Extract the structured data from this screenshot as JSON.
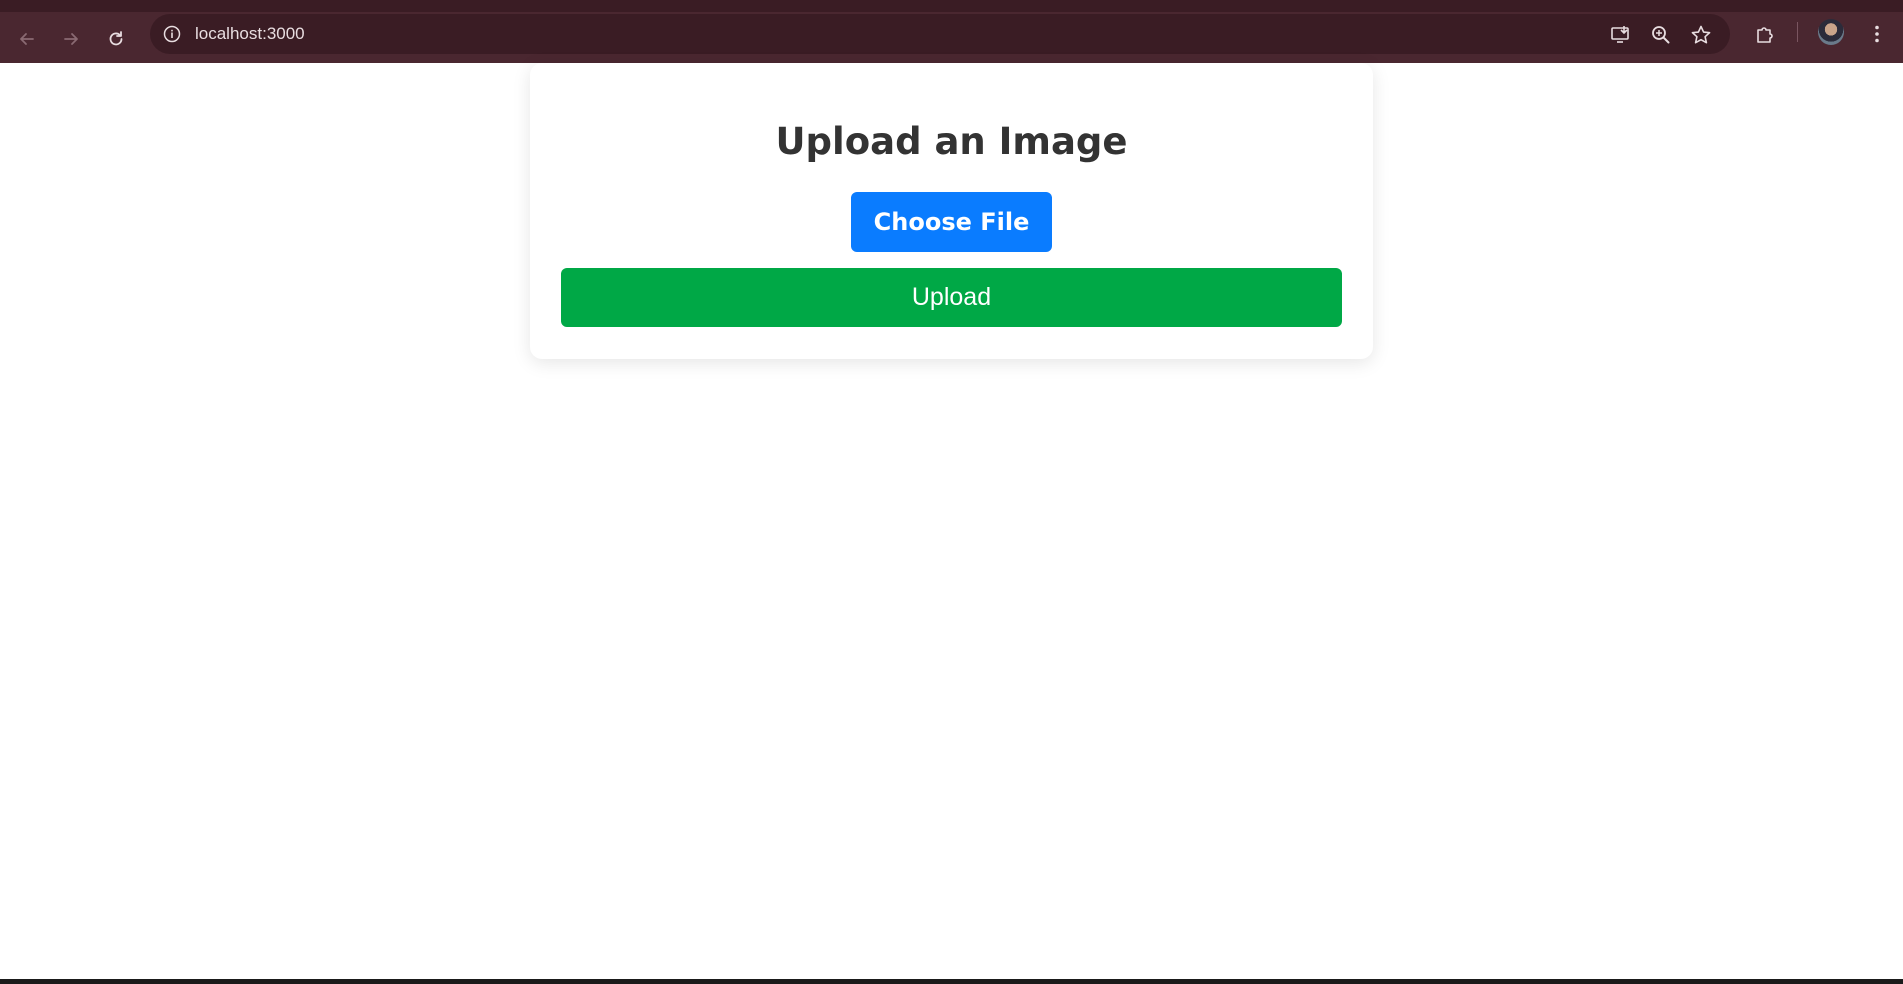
{
  "browser": {
    "url": "localhost:3000",
    "icons": {
      "back": "arrow-left-icon",
      "forward": "arrow-right-icon",
      "reload": "reload-icon",
      "site_info": "info-icon",
      "install": "install-app-icon",
      "zoom": "zoom-icon",
      "bookmark": "star-icon",
      "extensions": "puzzle-icon",
      "menu": "kebab-menu-icon"
    },
    "colors": {
      "frame": "#4a2730",
      "omnibox": "#3a1c24"
    }
  },
  "page": {
    "title": "Upload an Image",
    "choose_file_label": "Choose File",
    "upload_label": "Upload",
    "colors": {
      "choose_button": "#0a7cff",
      "upload_button": "#00a846",
      "title_text": "#333333"
    }
  }
}
